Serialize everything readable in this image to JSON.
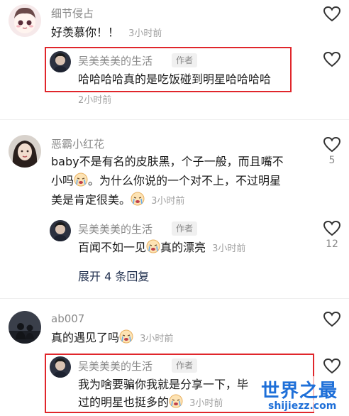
{
  "comments": [
    {
      "user": "细节侵占",
      "text": "好羡慕你！！",
      "time": "3小时前",
      "reply": {
        "user": "吴美美美的生活",
        "badge": "作者",
        "text": "哈哈哈哈真的是吃饭碰到明星哈哈哈哈",
        "time": "2小时前"
      }
    },
    {
      "user": "恶霸小红花",
      "text_line1": "baby不是有名的皮肤黑，个子一般，而且嘴不",
      "text_line2": "小吗",
      "text_line2b": "。为什么你说的一个对不上，不过明星",
      "text_line3": "美是肯定很美。",
      "time": "3小时前",
      "likes": "5",
      "reply": {
        "user": "吴美美美的生活",
        "badge": "作者",
        "text_a": "百闻不如一见",
        "text_b": "真的漂亮",
        "time": "3小时前",
        "likes": "12"
      },
      "expand": "展开 4 条回复"
    },
    {
      "user": "ab007",
      "text": "真的遇见了吗",
      "time": "3小时前",
      "reply": {
        "user": "吴美美美的生活",
        "badge": "作者",
        "text_line1": "我为啥要骗你我就是分享一下，毕",
        "text_line2": "过的明星也挺多的",
        "time": "3小时前"
      }
    }
  ],
  "watermark": {
    "title": "世界之最",
    "url": "shijiezz.com"
  },
  "colors": {
    "highlight": "#e0262b",
    "watermark": "#1e6fd8"
  }
}
